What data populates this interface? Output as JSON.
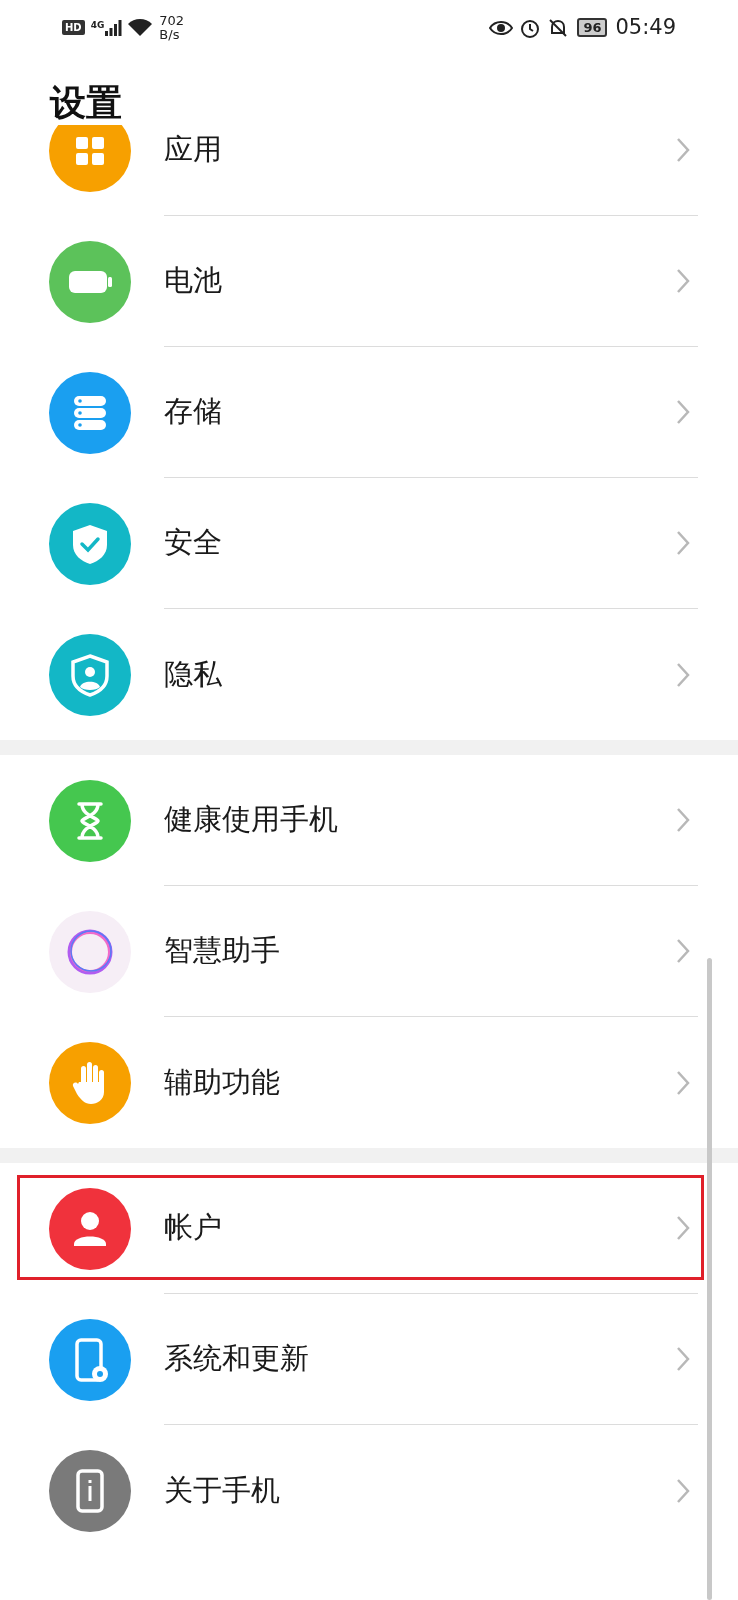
{
  "status_bar": {
    "hd_badge": "HD",
    "network": "4G",
    "speed": "702",
    "speed_unit": "B/s",
    "battery": "96",
    "time": "05:49"
  },
  "title": "设置",
  "sections": [
    {
      "items": [
        {
          "label": "应用",
          "kind": "apps",
          "highlighted": false
        },
        {
          "label": "电池",
          "kind": "battery",
          "highlighted": false
        },
        {
          "label": "存储",
          "kind": "storage",
          "highlighted": false
        },
        {
          "label": "安全",
          "kind": "security",
          "highlighted": false
        },
        {
          "label": "隐私",
          "kind": "privacy",
          "highlighted": false
        }
      ]
    },
    {
      "items": [
        {
          "label": "健康使用手机",
          "kind": "hourglass",
          "highlighted": false
        },
        {
          "label": "智慧助手",
          "kind": "assistant",
          "highlighted": false
        },
        {
          "label": "辅助功能",
          "kind": "hand",
          "highlighted": false
        }
      ]
    },
    {
      "items": [
        {
          "label": "帐户",
          "kind": "account",
          "highlighted": true
        },
        {
          "label": "系统和更新",
          "kind": "system",
          "highlighted": false
        },
        {
          "label": "关于手机",
          "kind": "about",
          "highlighted": false
        }
      ]
    }
  ]
}
